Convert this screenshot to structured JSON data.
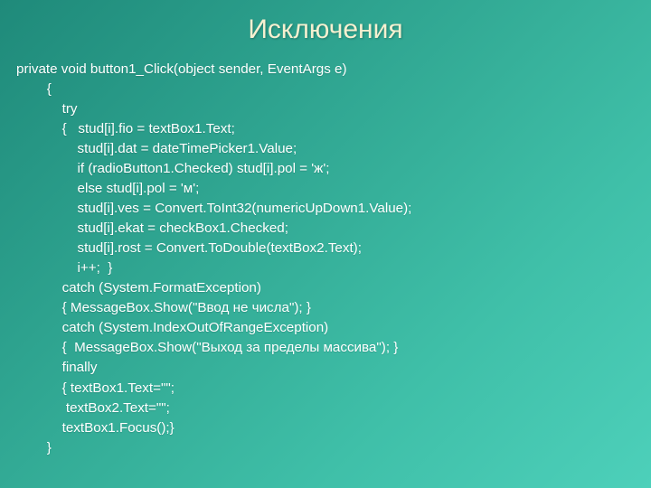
{
  "title": "Исключения",
  "code": "private void button1_Click(object sender, EventArgs e)\n        {\n            try\n            {   stud[i].fio = textBox1.Text;\n                stud[i].dat = dateTimePicker1.Value;\n                if (radioButton1.Checked) stud[i].pol = 'ж';\n                else stud[i].pol = 'м';\n                stud[i].ves = Convert.ToInt32(numericUpDown1.Value);\n                stud[i].ekat = checkBox1.Checked;\n                stud[i].rost = Convert.ToDouble(textBox2.Text);\n                i++;  }\n            catch (System.FormatException)\n            { MessageBox.Show(\"Ввод не числа\"); }\n            catch (System.IndexOutOfRangeException)\n            {  MessageBox.Show(\"Выход за пределы массива\"); }\n            finally\n            { textBox1.Text=\"\";\n             textBox2.Text=\"\";\n            textBox1.Focus();}\n        }"
}
